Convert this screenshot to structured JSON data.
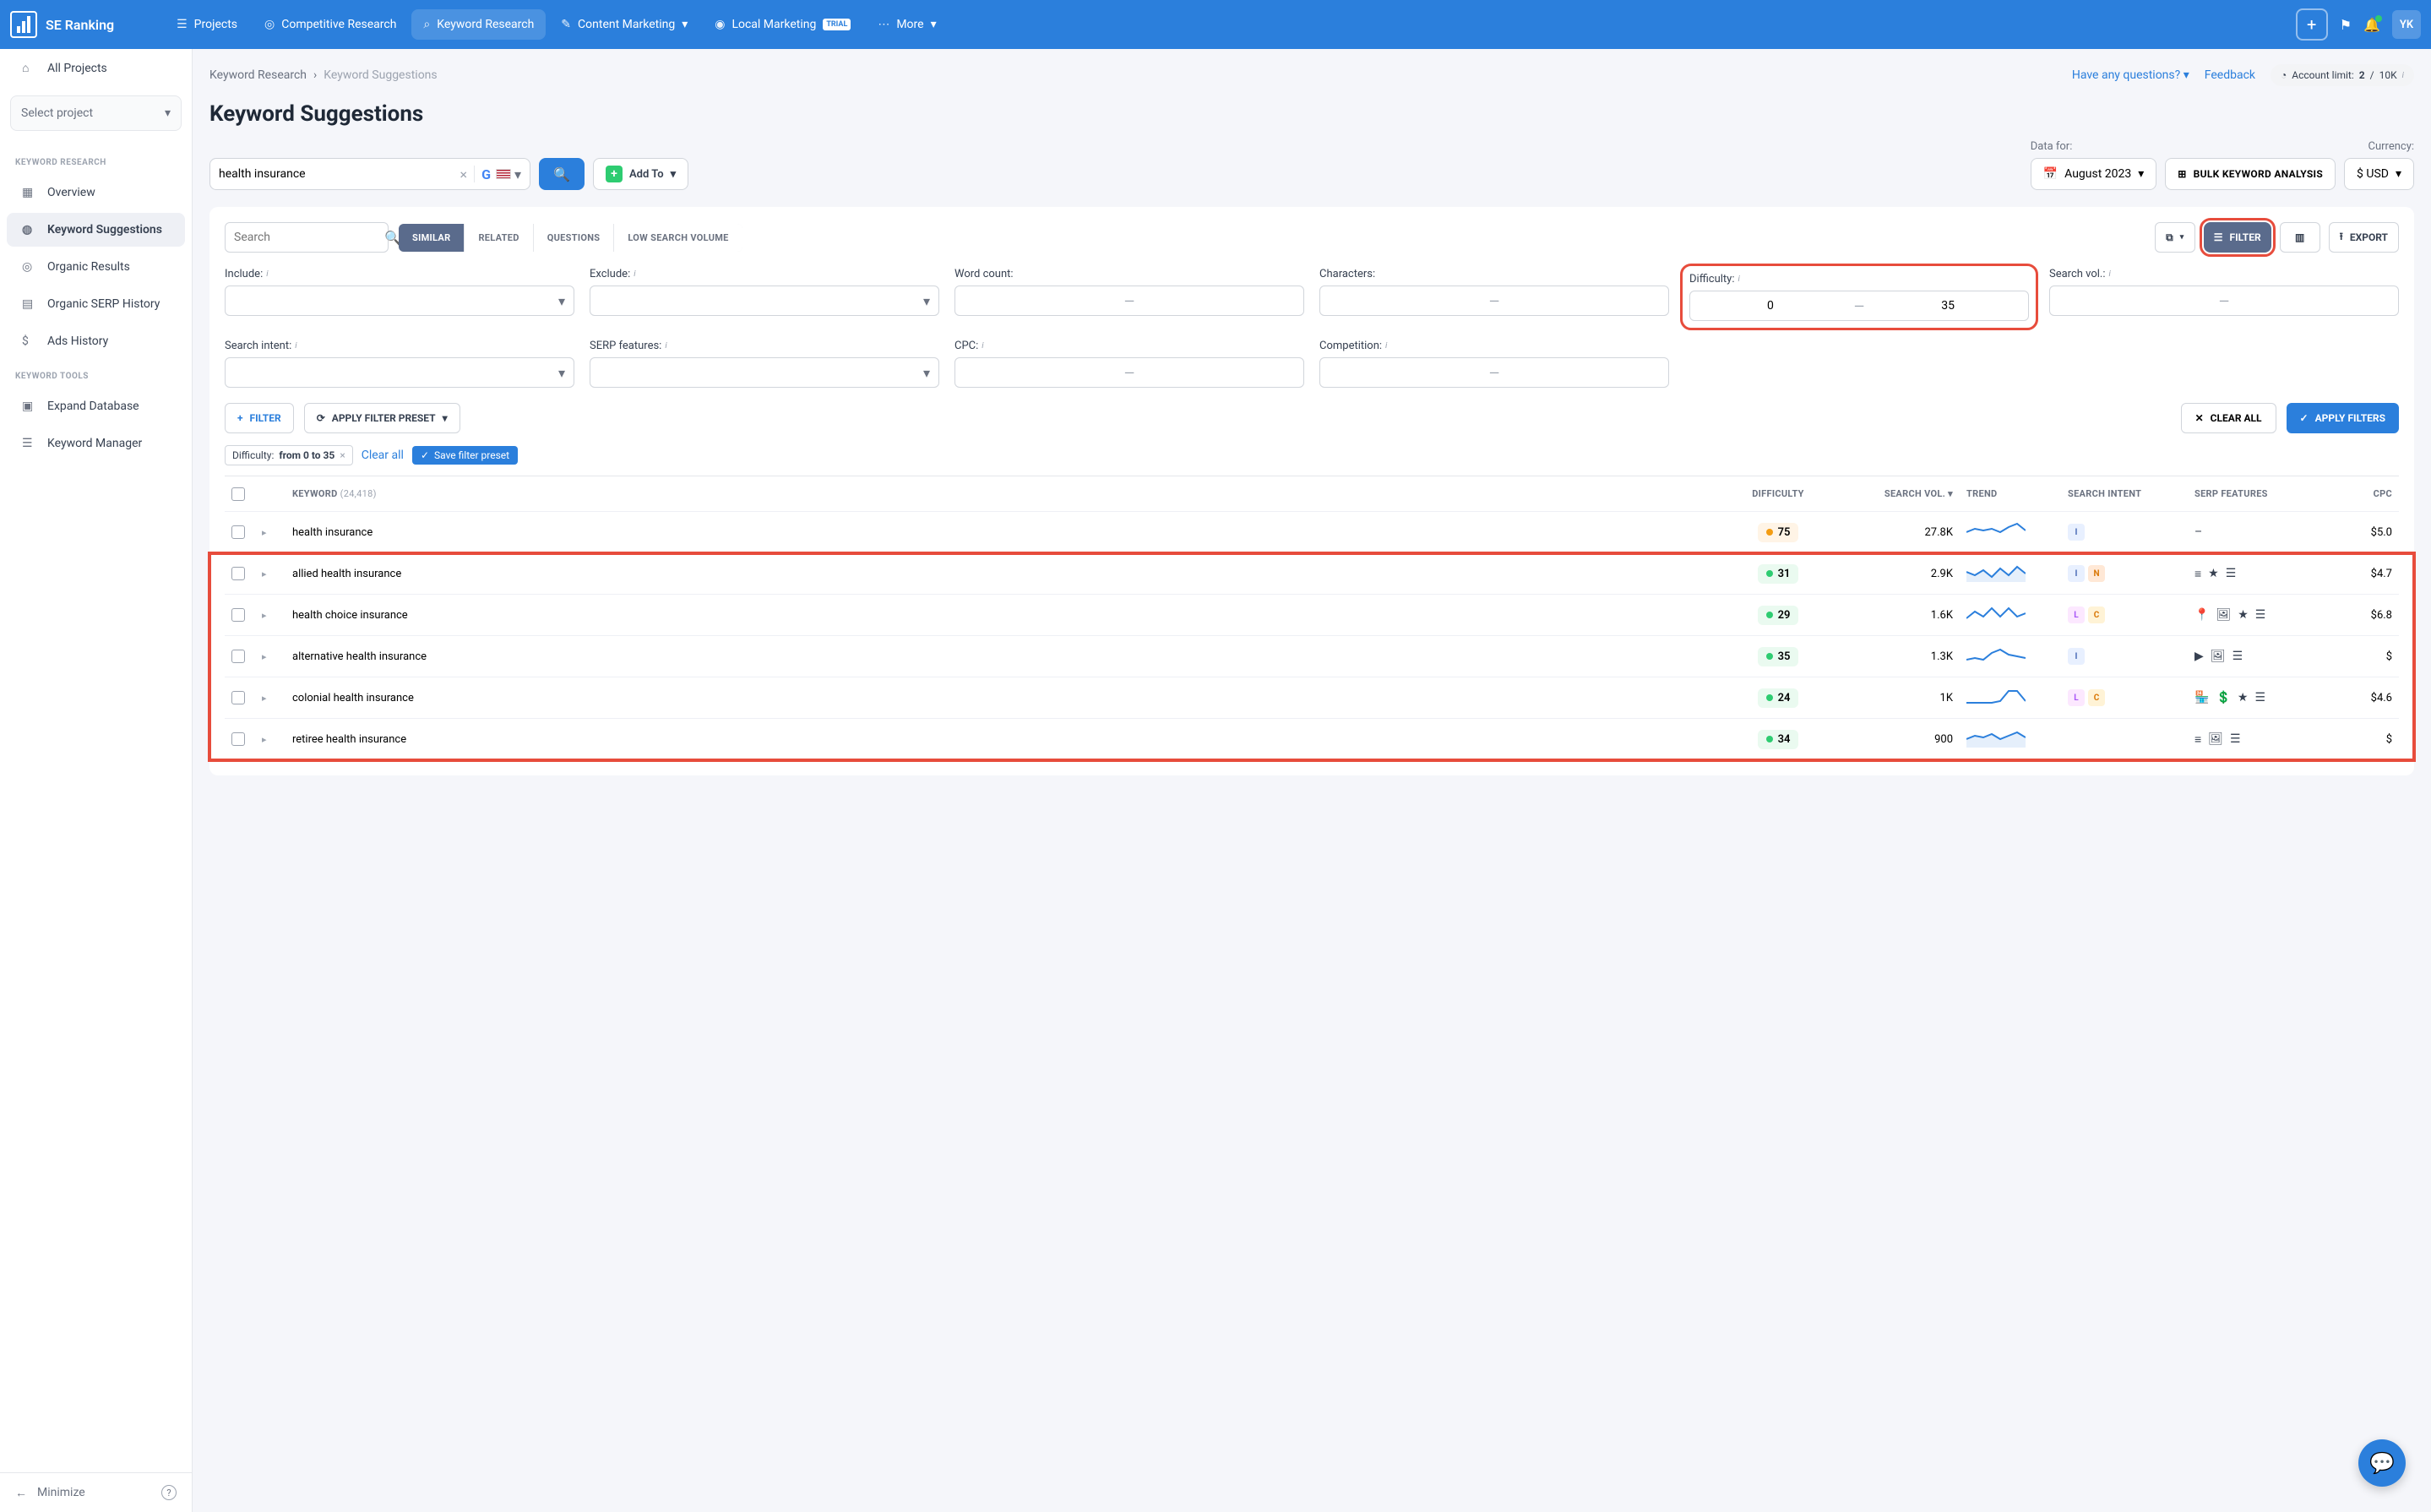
{
  "brand": "SE Ranking",
  "topnav": {
    "items": [
      "Projects",
      "Competitive Research",
      "Keyword Research",
      "Content Marketing",
      "Local Marketing",
      "More"
    ],
    "trial": "TRIAL",
    "avatar": "YK"
  },
  "sidebar": {
    "all_projects": "All Projects",
    "select_project": "Select project",
    "heading_research": "KEYWORD RESEARCH",
    "research_items": [
      "Overview",
      "Keyword Suggestions",
      "Organic Results",
      "Organic SERP History",
      "Ads History"
    ],
    "heading_tools": "KEYWORD TOOLS",
    "tools_items": [
      "Expand Database",
      "Keyword Manager"
    ],
    "minimize": "Minimize"
  },
  "breadcrumbs": {
    "a": "Keyword Research",
    "b": "Keyword Suggestions"
  },
  "bc_right": {
    "questions": "Have any questions?",
    "feedback": "Feedback",
    "limit_label": "Account limit:",
    "limit_used": "2",
    "limit_total": "10K"
  },
  "page_title": "Keyword Suggestions",
  "search": {
    "value": "health insurance"
  },
  "addto": "Add To",
  "controls": {
    "data_for_label": "Data for:",
    "date": "August 2023",
    "bulk": "BULK KEYWORD ANALYSIS",
    "currency_label": "Currency:",
    "currency": "$ USD"
  },
  "card": {
    "search_placeholder": "Search",
    "tabs": [
      "SIMILAR",
      "RELATED",
      "QUESTIONS",
      "LOW SEARCH VOLUME"
    ],
    "filter_btn": "FILTER",
    "export_btn": "EXPORT"
  },
  "filters": {
    "row1": [
      {
        "label": "Include:",
        "info": true,
        "type": "select"
      },
      {
        "label": "Exclude:",
        "info": true,
        "type": "select"
      },
      {
        "label": "Word count:",
        "type": "range",
        "from": "",
        "to": ""
      },
      {
        "label": "Characters:",
        "type": "range",
        "from": "",
        "to": ""
      },
      {
        "label": "Difficulty:",
        "info": true,
        "type": "range",
        "from": "0",
        "to": "35",
        "highlight": true
      },
      {
        "label": "Search vol.:",
        "info": true,
        "type": "range",
        "from": "",
        "to": ""
      }
    ],
    "row2": [
      {
        "label": "Search intent:",
        "info": true,
        "type": "select"
      },
      {
        "label": "SERP features:",
        "info": true,
        "type": "select"
      },
      {
        "label": "CPC:",
        "info": true,
        "type": "range",
        "from": "",
        "to": ""
      },
      {
        "label": "Competition:",
        "info": true,
        "type": "range",
        "from": "",
        "to": ""
      }
    ]
  },
  "filter_actions": {
    "add": "FILTER",
    "preset": "APPLY FILTER PRESET",
    "clear": "CLEAR ALL",
    "apply": "APPLY FILTERS"
  },
  "chips": {
    "label": "Difficulty:",
    "value": "from 0 to 35",
    "clear_all": "Clear all",
    "save": "Save filter preset"
  },
  "table": {
    "headers": {
      "keyword": "KEYWORD",
      "count": "(24,418)",
      "difficulty": "DIFFICULTY",
      "vol": "SEARCH VOL.",
      "trend": "TREND",
      "intent": "SEARCH INTENT",
      "serp": "SERP FEATURES",
      "cpc": "CPC"
    },
    "rows": [
      {
        "kw": "health insurance",
        "diff": 75,
        "diff_color": "orange",
        "vol": "27.8K",
        "spark": "0,14 10,10 20,12 30,10 40,14 50,8 60,4 70,12",
        "intent": [
          "I"
        ],
        "serp": [],
        "serp_dash": "–",
        "cpc": "$5.0"
      },
      {
        "kw": "allied health insurance",
        "diff": 31,
        "diff_color": "green",
        "vol": "2.9K",
        "spark": "0,12 10,16 20,10 30,18 40,8 50,16 60,6 70,14",
        "shaded": true,
        "intent": [
          "I",
          "N"
        ],
        "serp": [
          "list",
          "star",
          "menu"
        ],
        "cpc": "$4.7"
      },
      {
        "kw": "health choice insurance",
        "diff": 29,
        "diff_color": "green",
        "vol": "1.6K",
        "spark": "0,18 10,10 20,16 30,6 40,16 50,6 60,16 70,12",
        "intent": [
          "L",
          "C"
        ],
        "serp": [
          "pin",
          "image",
          "star",
          "menu"
        ],
        "cpc": "$6.8"
      },
      {
        "kw": "alternative health insurance",
        "diff": 35,
        "diff_color": "green",
        "vol": "1.3K",
        "spark": "0,18 10,16 20,18 30,10 40,6 50,12 60,14 70,16",
        "intent": [
          "I"
        ],
        "serp": [
          "video",
          "image",
          "menu"
        ],
        "cpc": "$"
      },
      {
        "kw": "colonial health insurance",
        "diff": 24,
        "diff_color": "green",
        "vol": "1K",
        "spark": "0,20 10,20 20,20 30,20 40,18 50,6 60,6 70,18",
        "intent": [
          "L",
          "C"
        ],
        "serp": [
          "shop",
          "dollar",
          "star",
          "menu"
        ],
        "cpc": "$4.6"
      },
      {
        "kw": "retiree health insurance",
        "diff": 34,
        "diff_color": "green",
        "vol": "900",
        "spark": "0,14 10,10 20,12 30,8 40,14 50,10 60,6 70,12",
        "shaded": true,
        "intent": [],
        "serp": [
          "list",
          "image",
          "menu"
        ],
        "cpc": "$"
      }
    ]
  }
}
